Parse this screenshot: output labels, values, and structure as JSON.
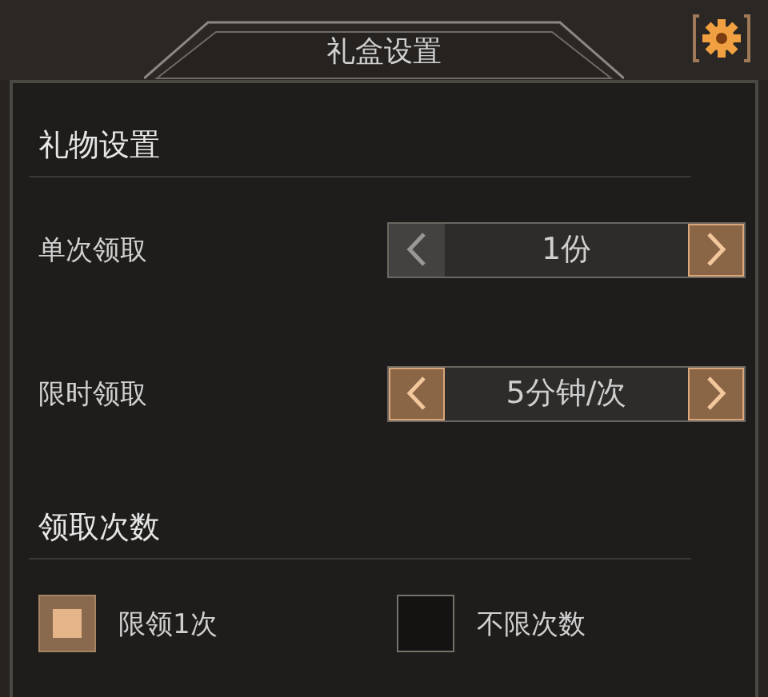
{
  "window": {
    "title": "礼盒设置"
  },
  "sections": [
    {
      "title": "礼物设置",
      "rows": [
        {
          "label": "单次领取",
          "value": "1份",
          "prev_enabled": false,
          "next_enabled": true
        },
        {
          "label": "限时领取",
          "value": "5分钟/次",
          "prev_enabled": true,
          "next_enabled": true
        }
      ]
    },
    {
      "title": "领取次数",
      "options": [
        {
          "label": "限领1次",
          "selected": true
        },
        {
          "label": "不限次数",
          "selected": false
        }
      ]
    }
  ]
}
